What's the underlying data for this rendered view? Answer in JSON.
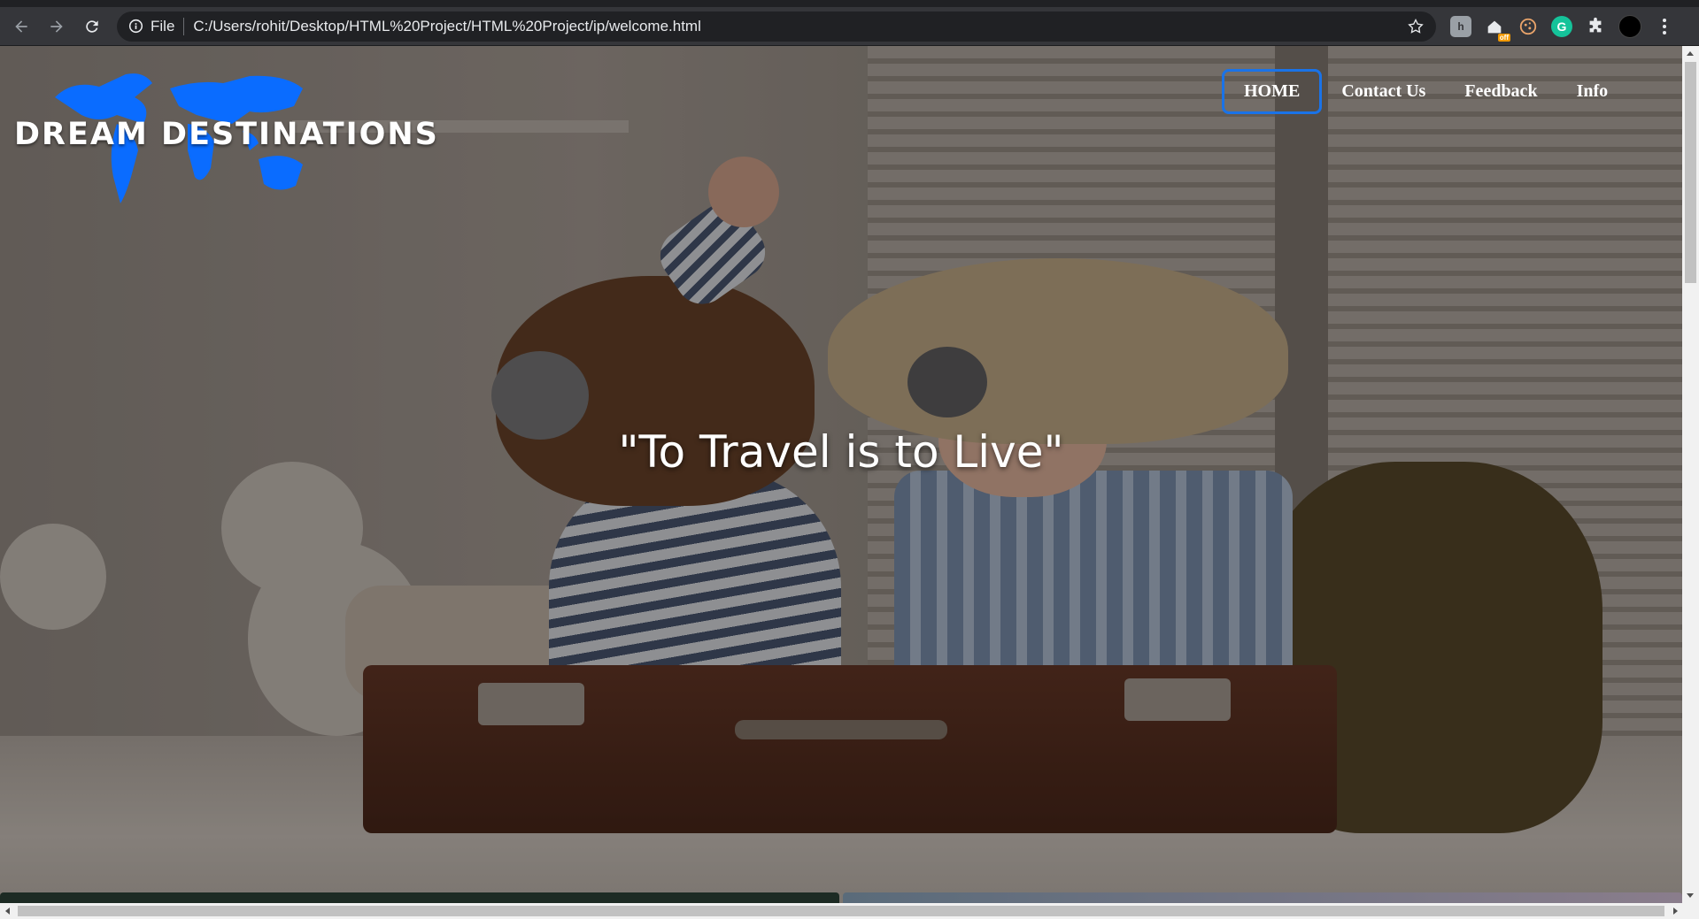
{
  "browser": {
    "file_label": "File",
    "url": "C:/Users/rohit/Desktop/HTML%20Project/HTML%20Project/ip/welcome.html",
    "extensions": {
      "hz_label": "h",
      "off_badge": "off",
      "grammarly_label": "G"
    }
  },
  "site": {
    "logo_text": "DREAM DESTINATIONS",
    "nav": [
      {
        "label": "HOME",
        "active": true
      },
      {
        "label": "Contact Us",
        "active": false
      },
      {
        "label": "Feedback",
        "active": false
      },
      {
        "label": "Info",
        "active": false
      }
    ],
    "tagline": "\"To Travel is to Live\""
  },
  "colors": {
    "accent": "#1a73e8",
    "map_blue": "#0a6cff"
  }
}
